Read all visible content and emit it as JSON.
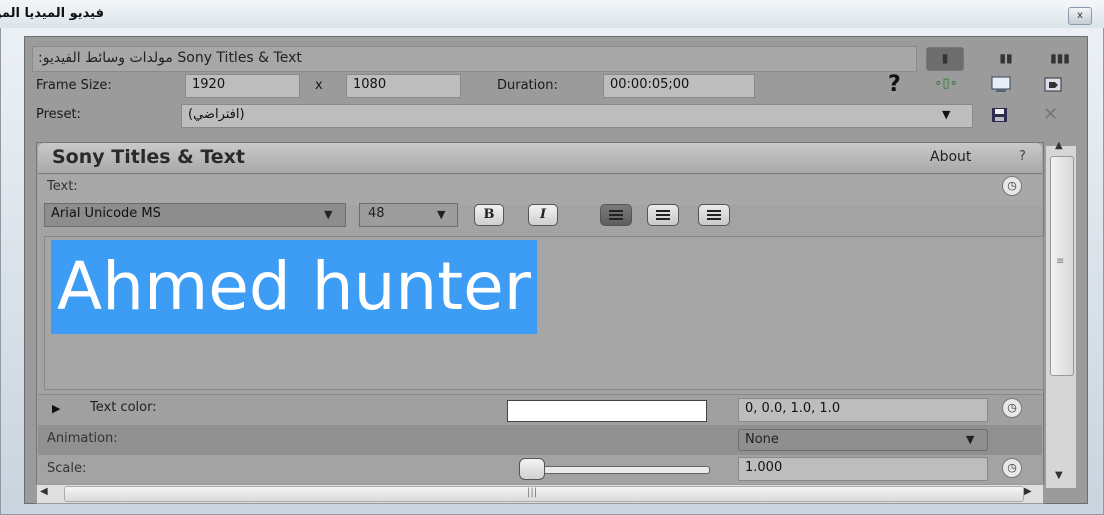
{
  "window": {
    "title": "فيديو الميديا المولدة",
    "close_label": "x"
  },
  "header": {
    "plugin_label": ":مولدات وسائط الفيديو Sony Titles & Text",
    "frame_size_label": "Frame Size:",
    "width_value": "1920",
    "x_label": "x",
    "height_value": "1080",
    "duration_label": "Duration:",
    "duration_value": "00:00:05;00",
    "help_label": "?",
    "preset_label": "Preset:",
    "preset_value": "(افتراضي)"
  },
  "panel": {
    "title": "Sony Titles & Text",
    "about_label": "About",
    "help_label": "?",
    "text_label": "Text:",
    "font_name": "Arial Unicode MS",
    "font_size": "48",
    "bold_label": "B",
    "italic_label": "I",
    "text_content": "Ahmed hunter",
    "text_color_label": "Text color:",
    "text_color_value": "0, 0.0, 1.0, 1.0",
    "text_color_swatch": "#ffffff",
    "animation_label": "Animation:",
    "animation_value": "None",
    "scale_label": "Scale:",
    "scale_value": "1.000"
  },
  "colors": {
    "selection": "#3d9df5",
    "panel_bg": "#a3a3a3"
  },
  "icons": [
    "close-icon",
    "view-single-icon",
    "view-double-icon",
    "view-triple-icon",
    "help-icon",
    "match-output-icon",
    "save-preset-icon",
    "delete-preset-icon",
    "keyframe-clock-icon",
    "expand-triangle-icon",
    "bold-icon",
    "italic-icon",
    "align-left-icon",
    "align-center-icon",
    "align-right-icon"
  ]
}
